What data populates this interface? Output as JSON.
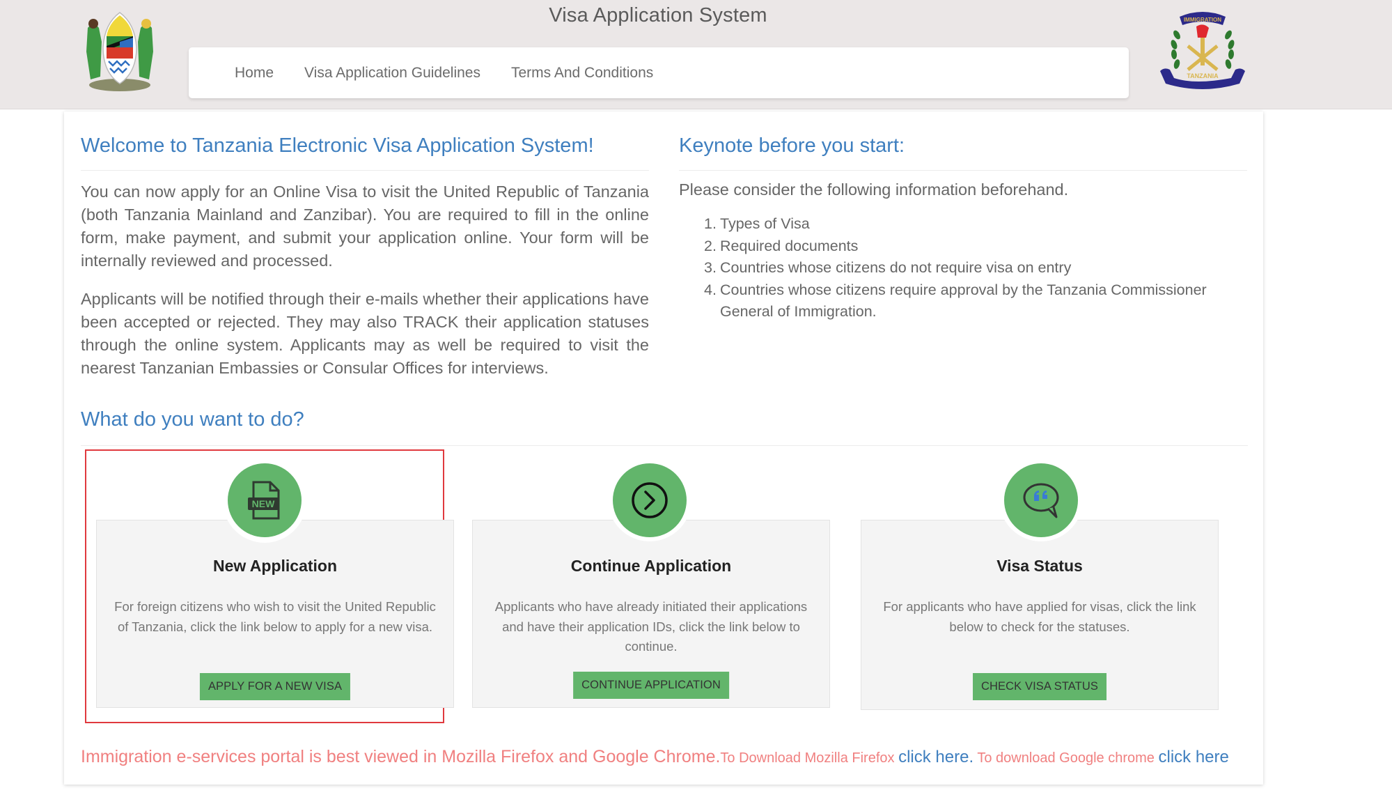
{
  "header": {
    "title": "Visa Application System",
    "left_logo": "tanzania-coat-of-arms",
    "right_logo": "immigration-tanzania-emblem",
    "right_logo_text_top": "IMMIGRATION",
    "right_logo_text_bottom": "TANZANIA"
  },
  "nav": {
    "items": [
      {
        "label": "Home"
      },
      {
        "label": "Visa Application Guidelines"
      },
      {
        "label": "Terms And Conditions"
      }
    ]
  },
  "welcome": {
    "heading": "Welcome to Tanzania Electronic Visa Application System!",
    "paragraphs": [
      "You can now apply for an Online Visa to visit the United Republic of Tanzania (both Tanzania Mainland and Zanzibar). You are required to fill in the online form, make payment, and submit your application online. Your form will be internally reviewed and processed.",
      "Applicants will be notified through their e-mails whether their applications have been accepted or rejected. They may also TRACK their application statuses through the online system. Applicants may as well be required to visit the nearest Tanzanian Embassies or Consular Offices for interviews."
    ]
  },
  "keynote": {
    "heading": "Keynote before you start:",
    "intro": "Please consider the following information beforehand.",
    "items": [
      {
        "num": "1.",
        "text": "Types of Visa"
      },
      {
        "num": "2.",
        "text": "Required documents"
      },
      {
        "num": "3.",
        "text": "Countries whose citizens do not require visa on entry"
      },
      {
        "num": "4.",
        "text": "Countries whose citizens require approval by the Tanzania Commissioner General of Immigration."
      }
    ]
  },
  "actions": {
    "heading": "What do you want to do?",
    "cards": [
      {
        "icon": "new-document-icon",
        "icon_text": "NEW",
        "title": "New Application",
        "description": "For foreign citizens who wish to visit the United Republic of Tanzania, click the link below to apply for a new visa.",
        "button": "APPLY FOR A NEW VISA",
        "highlighted": true
      },
      {
        "icon": "chevron-right-circle-icon",
        "title": "Continue Application",
        "description": "Applicants who have already initiated their applications and have their application IDs, click the link below to continue.",
        "button": "CONTINUE APPLICATION",
        "highlighted": false
      },
      {
        "icon": "speech-bubble-quote-icon",
        "title": "Visa Status",
        "description": "For applicants who have applied for visas, click the link below to check for the statuses.",
        "button": "CHECK VISA STATUS",
        "highlighted": false
      }
    ]
  },
  "notice": {
    "text_main": "Immigration e-services portal is best viewed in Mozilla Firefox and Google Chrome.",
    "text_firefox": "To Download Mozilla Firefox ",
    "link_firefox": "click here.",
    "text_chrome": " To download Google chrome ",
    "link_chrome": "click here"
  },
  "colors": {
    "accent_blue": "#3f7fbf",
    "button_green": "#62b56b",
    "notice_red": "#f08080",
    "highlight_border": "#e0393e",
    "header_bg": "#ebe7e7"
  }
}
